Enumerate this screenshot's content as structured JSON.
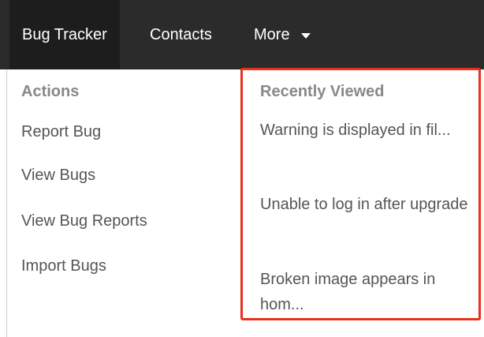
{
  "nav": {
    "items": [
      "Bug Tracker",
      "Contacts",
      "More"
    ]
  },
  "actions": {
    "header": "Actions",
    "items": [
      "Report Bug",
      "View Bugs",
      "View Bug Reports",
      "Import Bugs"
    ]
  },
  "recently_viewed": {
    "header": "Recently Viewed",
    "items": [
      "Warning is displayed in fil...",
      "Unable to log in after upgrade",
      "Broken image appears in hom..."
    ]
  },
  "colors": {
    "nav_bg": "#2b2b2b",
    "highlight": "#e8301c"
  },
  "icons": [
    "chevron-down-icon"
  ]
}
